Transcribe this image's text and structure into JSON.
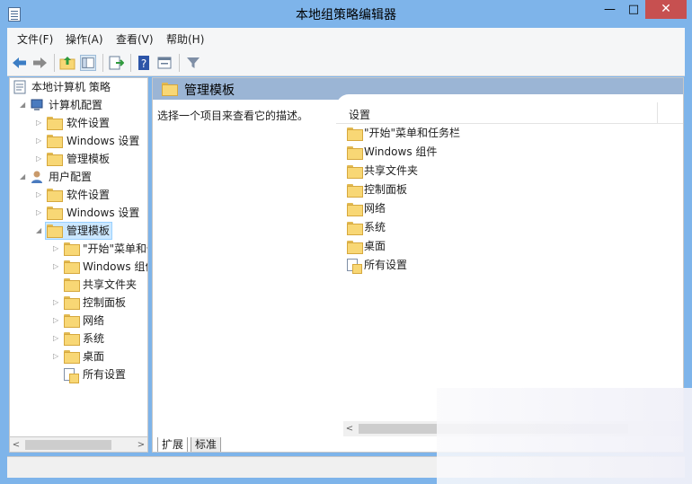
{
  "window": {
    "title": "本地组策略编辑器",
    "minimize": "—",
    "maximize": "□",
    "close": "✕",
    "accent": "#7eb4ea"
  },
  "menubar": [
    "文件(F)",
    "操作(A)",
    "查看(V)",
    "帮助(H)"
  ],
  "toolbar": {
    "icons": [
      "back-icon",
      "forward-icon",
      "up-folder-icon",
      "show-hide-tree-icon",
      "export-list-icon",
      "help-icon",
      "properties-icon",
      "filter-icon"
    ]
  },
  "tree": {
    "root": "本地计算机 策略",
    "computer_config": "计算机配置",
    "user_config": "用户配置",
    "computer_children": [
      "软件设置",
      "Windows 设置",
      "管理模板"
    ],
    "user_children": [
      "软件设置",
      "Windows 设置",
      "管理模板"
    ],
    "admin_children": [
      "\"开始\"菜单和任务栏",
      "Windows 组件",
      "共享文件夹",
      "控制面板",
      "网络",
      "系统",
      "桌面",
      "所有设置"
    ]
  },
  "right": {
    "header": "管理模板",
    "description": "选择一个项目来查看它的描述。",
    "column": "设置",
    "items": [
      "\"开始\"菜单和任务栏",
      "Windows 组件",
      "共享文件夹",
      "控制面板",
      "网络",
      "系统",
      "桌面",
      "所有设置"
    ]
  },
  "tabs": [
    "扩展",
    "标准"
  ]
}
